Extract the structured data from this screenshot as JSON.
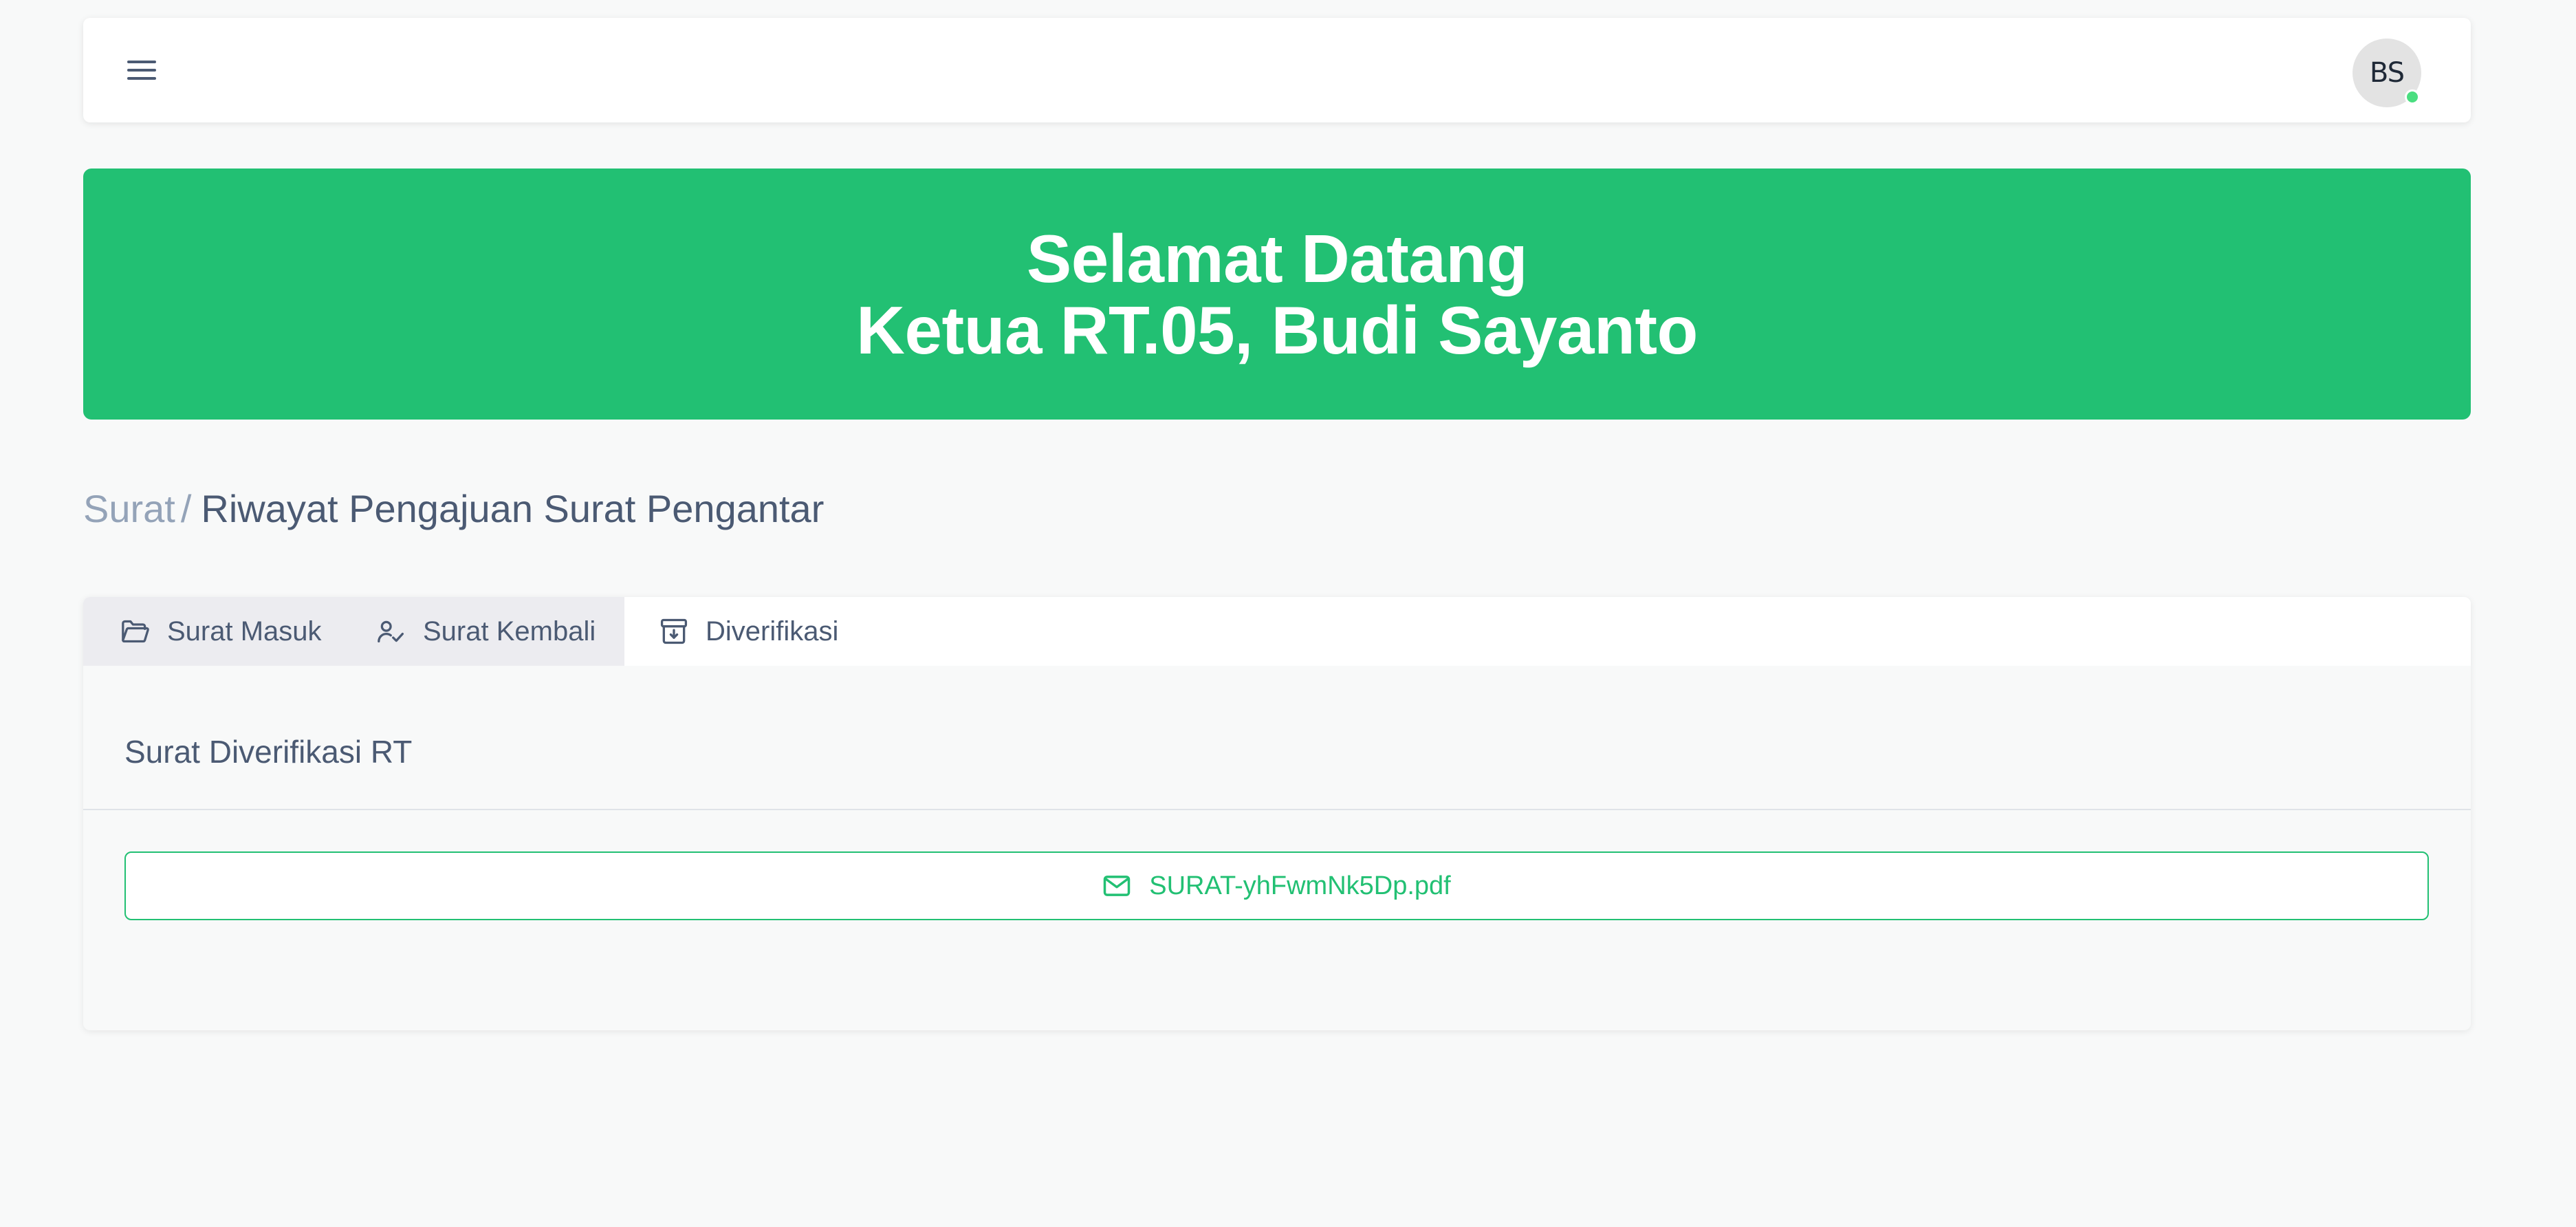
{
  "navbar": {
    "menu_icon": "hamburger-menu-icon",
    "avatar_initials": "BS",
    "status_color": "#4ade80"
  },
  "banner": {
    "line1": "Selamat Datang",
    "line2": "Ketua RT.05, Budi Sayanto",
    "background_color": "#22c073"
  },
  "breadcrumb": {
    "parent": "Surat",
    "separator": "/",
    "current": "Riwayat Pengajuan Surat Pengantar"
  },
  "tabs": [
    {
      "label": "Surat Masuk",
      "icon": "folder-open-icon",
      "active": false
    },
    {
      "label": "Surat Kembali",
      "icon": "user-check-icon",
      "active": false
    },
    {
      "label": "Diverifikasi",
      "icon": "archive-download-icon",
      "active": true
    }
  ],
  "panel": {
    "title": "Surat Diverifikasi RT",
    "file": {
      "icon": "envelope-icon",
      "name": "SURAT-yhFwmNk5Dp.pdf"
    }
  },
  "colors": {
    "accent": "#22c073",
    "text": "#4b5a73",
    "muted": "#94a3b8"
  }
}
